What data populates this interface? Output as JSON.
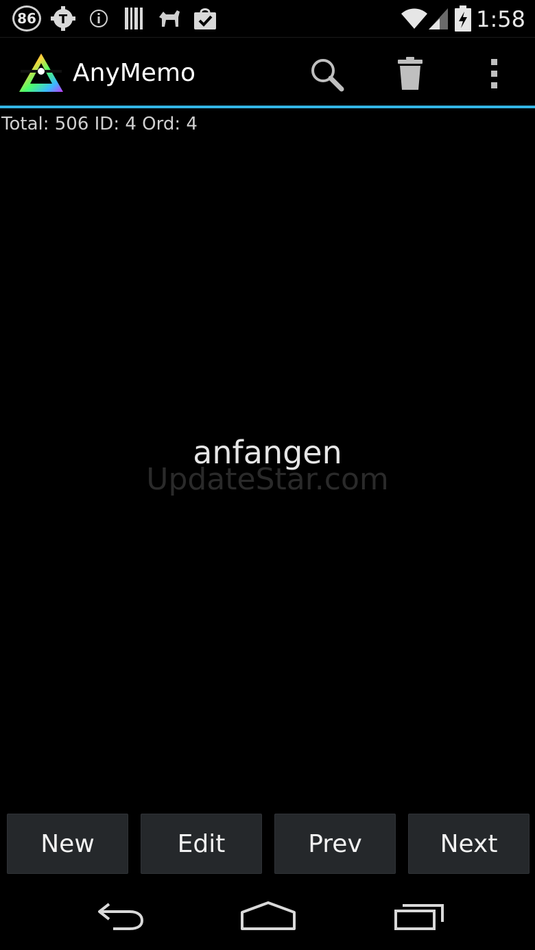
{
  "status_bar": {
    "badge": "86",
    "clock": "1:58",
    "icons": [
      "notification-badge-icon",
      "gear-notification-icon",
      "info-icon",
      "barcode-icon",
      "animal-icon",
      "shopping-bag-check-icon",
      "wifi-icon",
      "signal-icon",
      "battery-charging-icon"
    ]
  },
  "action_bar": {
    "title": "AnyMemo",
    "icons": [
      "search-icon",
      "trash-icon",
      "overflow-menu-icon"
    ],
    "accent_color": "#33b5e5"
  },
  "info": {
    "text": "Total: 506 ID: 4 Ord: 4"
  },
  "card": {
    "word": "anfangen",
    "watermark": "UpdateStar.com"
  },
  "buttons": {
    "new": "New",
    "edit": "Edit",
    "prev": "Prev",
    "next": "Next"
  },
  "nav_bar": {
    "icons": [
      "back-icon",
      "home-icon",
      "recent-apps-icon"
    ]
  }
}
